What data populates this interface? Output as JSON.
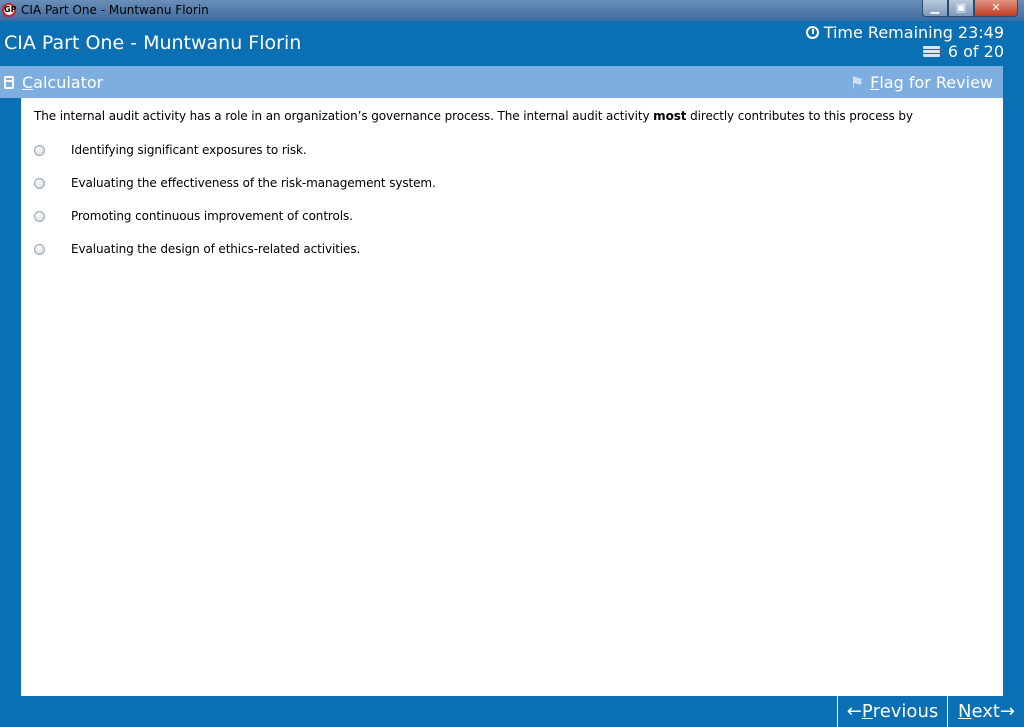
{
  "window": {
    "title": "CIA Part One - Muntwanu Florin",
    "controls": {
      "minimize": "▁",
      "restore": "▣",
      "close": "✕"
    }
  },
  "header": {
    "app_title": "CIA Part One - Muntwanu Florin",
    "time_label": "Time Remaining",
    "time_value": "23:49",
    "progress": "6 of 20"
  },
  "toolbar": {
    "calculator_first": "C",
    "calculator_rest": "alculator",
    "flag_first": "F",
    "flag_rest": "lag for Review"
  },
  "question": {
    "text_before": "The internal audit activity has a role in an organization’s governance process. The internal audit activity ",
    "text_bold": "most",
    "text_after": " directly contributes to this process by",
    "options": [
      {
        "label": "Identifying significant exposures to risk.",
        "selected": false
      },
      {
        "label": "Evaluating the effectiveness of the risk-management system.",
        "selected": false
      },
      {
        "label": "Promoting continuous improvement of controls.",
        "selected": false
      },
      {
        "label": "Evaluating the design of ethics-related activities.",
        "selected": false
      }
    ]
  },
  "footer": {
    "previous_arrow": "←",
    "previous_first": "P",
    "previous_rest": "revious",
    "next_first": "N",
    "next_rest": "ext",
    "next_arrow": "→"
  },
  "colors": {
    "primary": "#0a6fb3",
    "toolbar": "#7eaee0",
    "content_bg": "#ffffff"
  }
}
